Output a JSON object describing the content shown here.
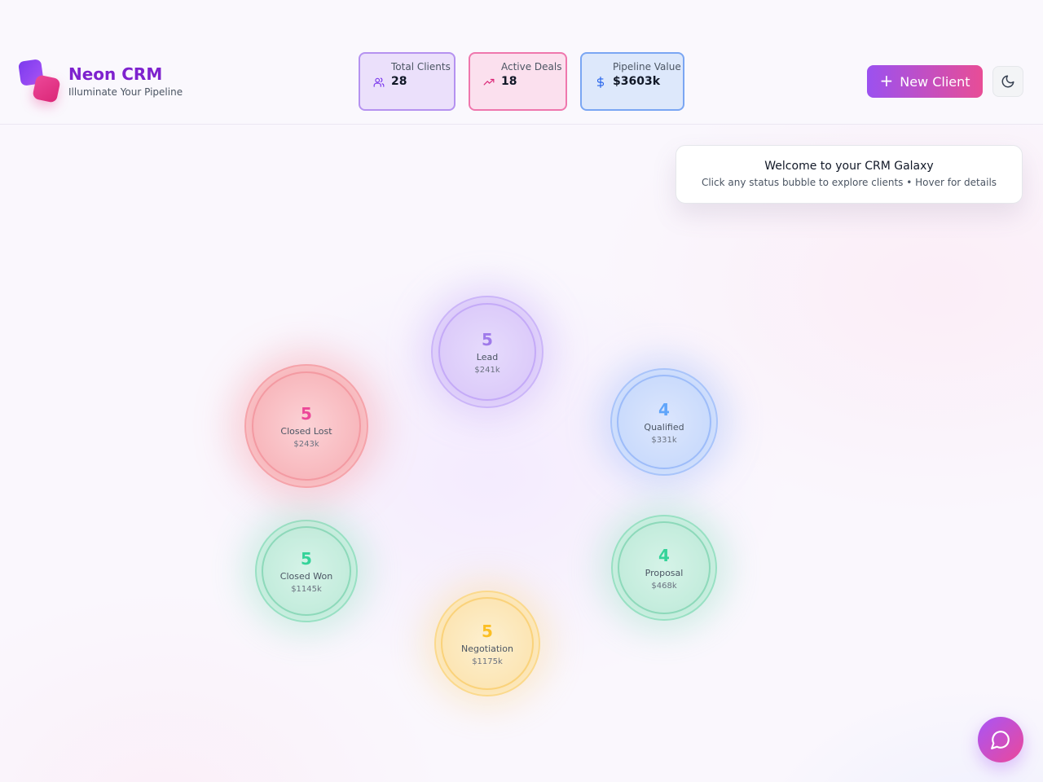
{
  "app": {
    "title": "Neon CRM",
    "subtitle": "Illuminate Your Pipeline"
  },
  "stats": [
    {
      "label": "Total Clients",
      "value": "28",
      "icon": "users-icon",
      "color": "#7c3aed"
    },
    {
      "label": "Active Deals",
      "value": "18",
      "icon": "trending-up-icon",
      "color": "#db2777"
    },
    {
      "label": "Pipeline Value",
      "value": "$3603k",
      "icon": "dollar-icon",
      "color": "#2563eb"
    }
  ],
  "actions": {
    "new_client_label": "New Client",
    "theme_toggle_icon": "moon-icon",
    "chat_icon": "chat-icon"
  },
  "welcome": {
    "title": "Welcome to your CRM Galaxy",
    "subtitle": "Click any status bubble to explore clients • Hover for details"
  },
  "pipeline": [
    {
      "status": "Lead",
      "count": "5",
      "value": "$241k",
      "color": "#a78bfa"
    },
    {
      "status": "Qualified",
      "count": "4",
      "value": "$331k",
      "color": "#60a5fa"
    },
    {
      "status": "Proposal",
      "count": "4",
      "value": "$468k",
      "color": "#34d399"
    },
    {
      "status": "Negotiation",
      "count": "5",
      "value": "$1175k",
      "color": "#fbbf24"
    },
    {
      "status": "Closed Won",
      "count": "5",
      "value": "$1145k",
      "color": "#34d399"
    },
    {
      "status": "Closed Lost",
      "count": "5",
      "value": "$243k",
      "color": "#f87171"
    }
  ]
}
